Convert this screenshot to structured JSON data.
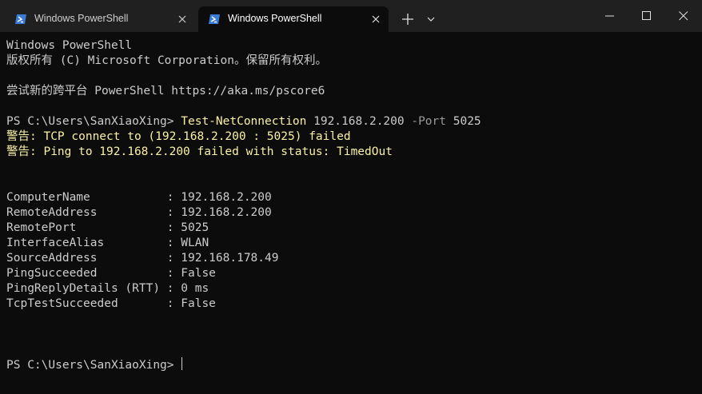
{
  "tabs": [
    {
      "title": "Windows PowerShell",
      "active": false
    },
    {
      "title": "Windows PowerShell",
      "active": true
    }
  ],
  "window_controls": [
    "minimize",
    "maximize",
    "close"
  ],
  "terminal": {
    "header_line1": "Windows PowerShell",
    "header_line2": "版权所有 (C) Microsoft Corporation。保留所有权利。",
    "header_line3": "尝试新的跨平台 PowerShell https://aka.ms/pscore6",
    "prompt": "PS C:\\Users\\SanXiaoXing> ",
    "command": {
      "cmdlet": "Test-NetConnection",
      "arg": " 192.168.2.200 ",
      "param": "-Port",
      "param_value": " 5025"
    },
    "warning1": "警告: TCP connect to (192.168.2.200 : 5025) failed",
    "warning2": "警告: Ping to 192.168.2.200 failed with status: TimedOut",
    "results": [
      {
        "key": "ComputerName           ",
        "value": ": 192.168.2.200"
      },
      {
        "key": "RemoteAddress          ",
        "value": ": 192.168.2.200"
      },
      {
        "key": "RemotePort             ",
        "value": ": 5025"
      },
      {
        "key": "InterfaceAlias         ",
        "value": ": WLAN"
      },
      {
        "key": "SourceAddress          ",
        "value": ": 192.168.178.49"
      },
      {
        "key": "PingSucceeded          ",
        "value": ": False"
      },
      {
        "key": "PingReplyDetails (RTT) ",
        "value": ": 0 ms"
      },
      {
        "key": "TcpTestSucceeded       ",
        "value": ": False"
      }
    ],
    "final_prompt": "PS C:\\Users\\SanXiaoXing> "
  },
  "colors": {
    "background": "#0c0c0c",
    "titlebar": "#202020",
    "foreground": "#cccccc",
    "command": "#f9f1a5",
    "parameter": "#9a9a9a",
    "warning": "#f9f1a5",
    "powershell_icon": "#3a7bd5"
  }
}
